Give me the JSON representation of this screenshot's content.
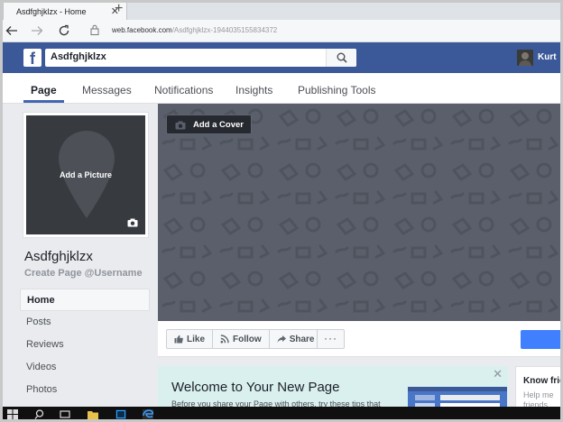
{
  "browser": {
    "tab_title": "Asdfghjklzx - Home",
    "tab_close": "✕",
    "new_tab": "+",
    "url_host": "web.facebook.com",
    "url_path": "/Asdfghjklzx-1944035155834372",
    "back_icon": "back-arrow-icon",
    "forward_icon": "forward-arrow-icon",
    "refresh_icon": "refresh-icon"
  },
  "header": {
    "logo": "f",
    "search_value": "Asdfghjklzx",
    "user_name": "Kurt",
    "brand_color": "#3b5998"
  },
  "page_tabs": [
    {
      "label": "Page",
      "active": true
    },
    {
      "label": "Messages"
    },
    {
      "label": "Notifications"
    },
    {
      "label": "Insights"
    },
    {
      "label": "Publishing Tools"
    }
  ],
  "profile": {
    "add_picture": "Add a Picture",
    "name": "Asdfghjklzx",
    "username_cta": "Create Page @Username"
  },
  "left_nav": [
    {
      "label": "Home",
      "active": true
    },
    {
      "label": "Posts"
    },
    {
      "label": "Reviews"
    },
    {
      "label": "Videos"
    },
    {
      "label": "Photos"
    }
  ],
  "cover": {
    "add_cover": "Add a Cover"
  },
  "actions": {
    "like": "Like",
    "follow": "Follow",
    "share": "Share",
    "more": "···"
  },
  "welcome": {
    "title": "Welcome to Your New Page",
    "body": "Before you share your Page with others, try these tips that",
    "close": "✕"
  },
  "know_friends": {
    "title": "Know frie",
    "body": "Help me friends"
  }
}
